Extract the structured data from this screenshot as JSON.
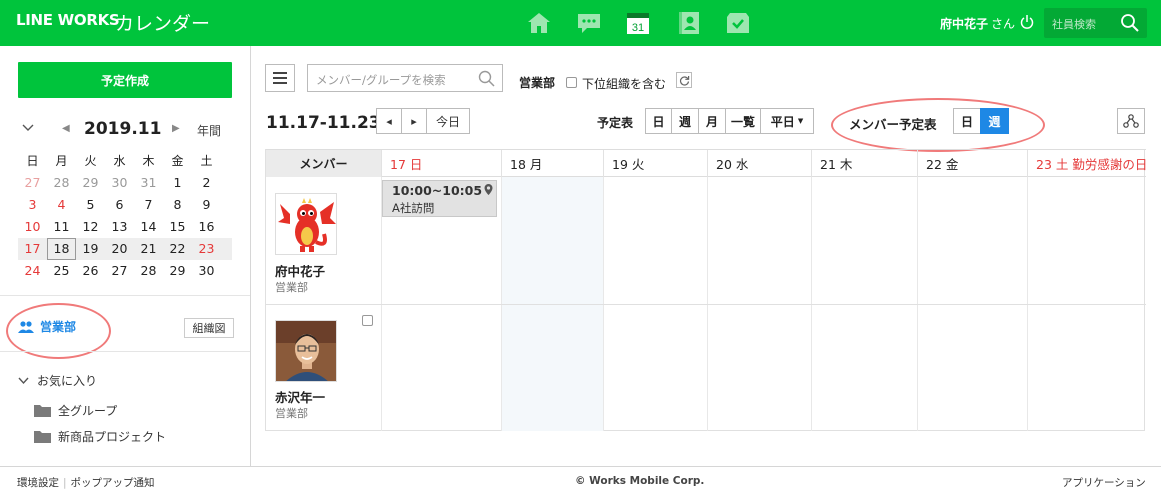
{
  "header": {
    "brand": "LINE WORKS",
    "app_title": "カレンダー",
    "nav_icons": [
      "home-icon",
      "chat-icon",
      "calendar-icon",
      "contacts-icon",
      "inbox-icon"
    ],
    "calendar_icon_day": "31",
    "user_name": "府中花子",
    "user_suffix": "さん",
    "search_placeholder": "社員検索"
  },
  "sidebar": {
    "create_button": "予定作成",
    "mini_calendar": {
      "title": "2019.11",
      "year_label": "年間",
      "weekdays": [
        "日",
        "月",
        "火",
        "水",
        "木",
        "金",
        "土"
      ],
      "weeks": [
        [
          "27",
          "28",
          "29",
          "30",
          "31",
          "1",
          "2"
        ],
        [
          "3",
          "4",
          "5",
          "6",
          "7",
          "8",
          "9"
        ],
        [
          "10",
          "11",
          "12",
          "13",
          "14",
          "15",
          "16"
        ],
        [
          "17",
          "18",
          "19",
          "20",
          "21",
          "22",
          "23"
        ],
        [
          "24",
          "25",
          "26",
          "27",
          "28",
          "29",
          "30"
        ]
      ],
      "today": "18"
    },
    "group_label": "営業部",
    "org_chart_button": "組織図",
    "favorites_label": "お気に入り",
    "favorites": [
      "全グループ",
      "新商品プロジェクト"
    ]
  },
  "toolbar": {
    "member_search_placeholder": "メンバー/グループを検索",
    "dept_label": "営業部",
    "include_sub_label": "下位組織を含む",
    "range": "11.17-11.23",
    "prev": "◂",
    "next": "▸",
    "today_btn": "今日",
    "schedule_label": "予定表",
    "schedule_views": [
      "日",
      "週",
      "月",
      "一覧",
      "平日"
    ],
    "member_schedule_label": "メンバー予定表",
    "member_views": [
      "日",
      "週"
    ],
    "member_view_active": "週"
  },
  "calendar": {
    "member_header": "メンバー",
    "days": [
      {
        "label": "17 日",
        "red": true
      },
      {
        "label": "18 月",
        "red": false
      },
      {
        "label": "19 火",
        "red": false
      },
      {
        "label": "20 水",
        "red": false
      },
      {
        "label": "21 木",
        "red": false
      },
      {
        "label": "22 金",
        "red": false
      },
      {
        "label": "23 土  勤労感謝の日",
        "red": true
      }
    ],
    "members": [
      {
        "name": "府中花子",
        "dept": "営業部",
        "avatar": "dragon-avatar"
      },
      {
        "name": "赤沢年一",
        "dept": "営業部",
        "avatar": "man-photo-avatar"
      }
    ],
    "event": {
      "time": "10:00~10:05",
      "title": "A社訪問",
      "day": "17 日",
      "member": "府中花子"
    }
  },
  "footer": {
    "settings": "環境設定",
    "popup": "ポップアップ通知",
    "copyright": "© Works Mobile Corp.",
    "apps": "アプリケーション"
  },
  "colors": {
    "brand_green": "#00c43c",
    "accent_blue": "#1e88e5",
    "holiday_red": "#e53939",
    "annotation": "#f07a7a"
  }
}
